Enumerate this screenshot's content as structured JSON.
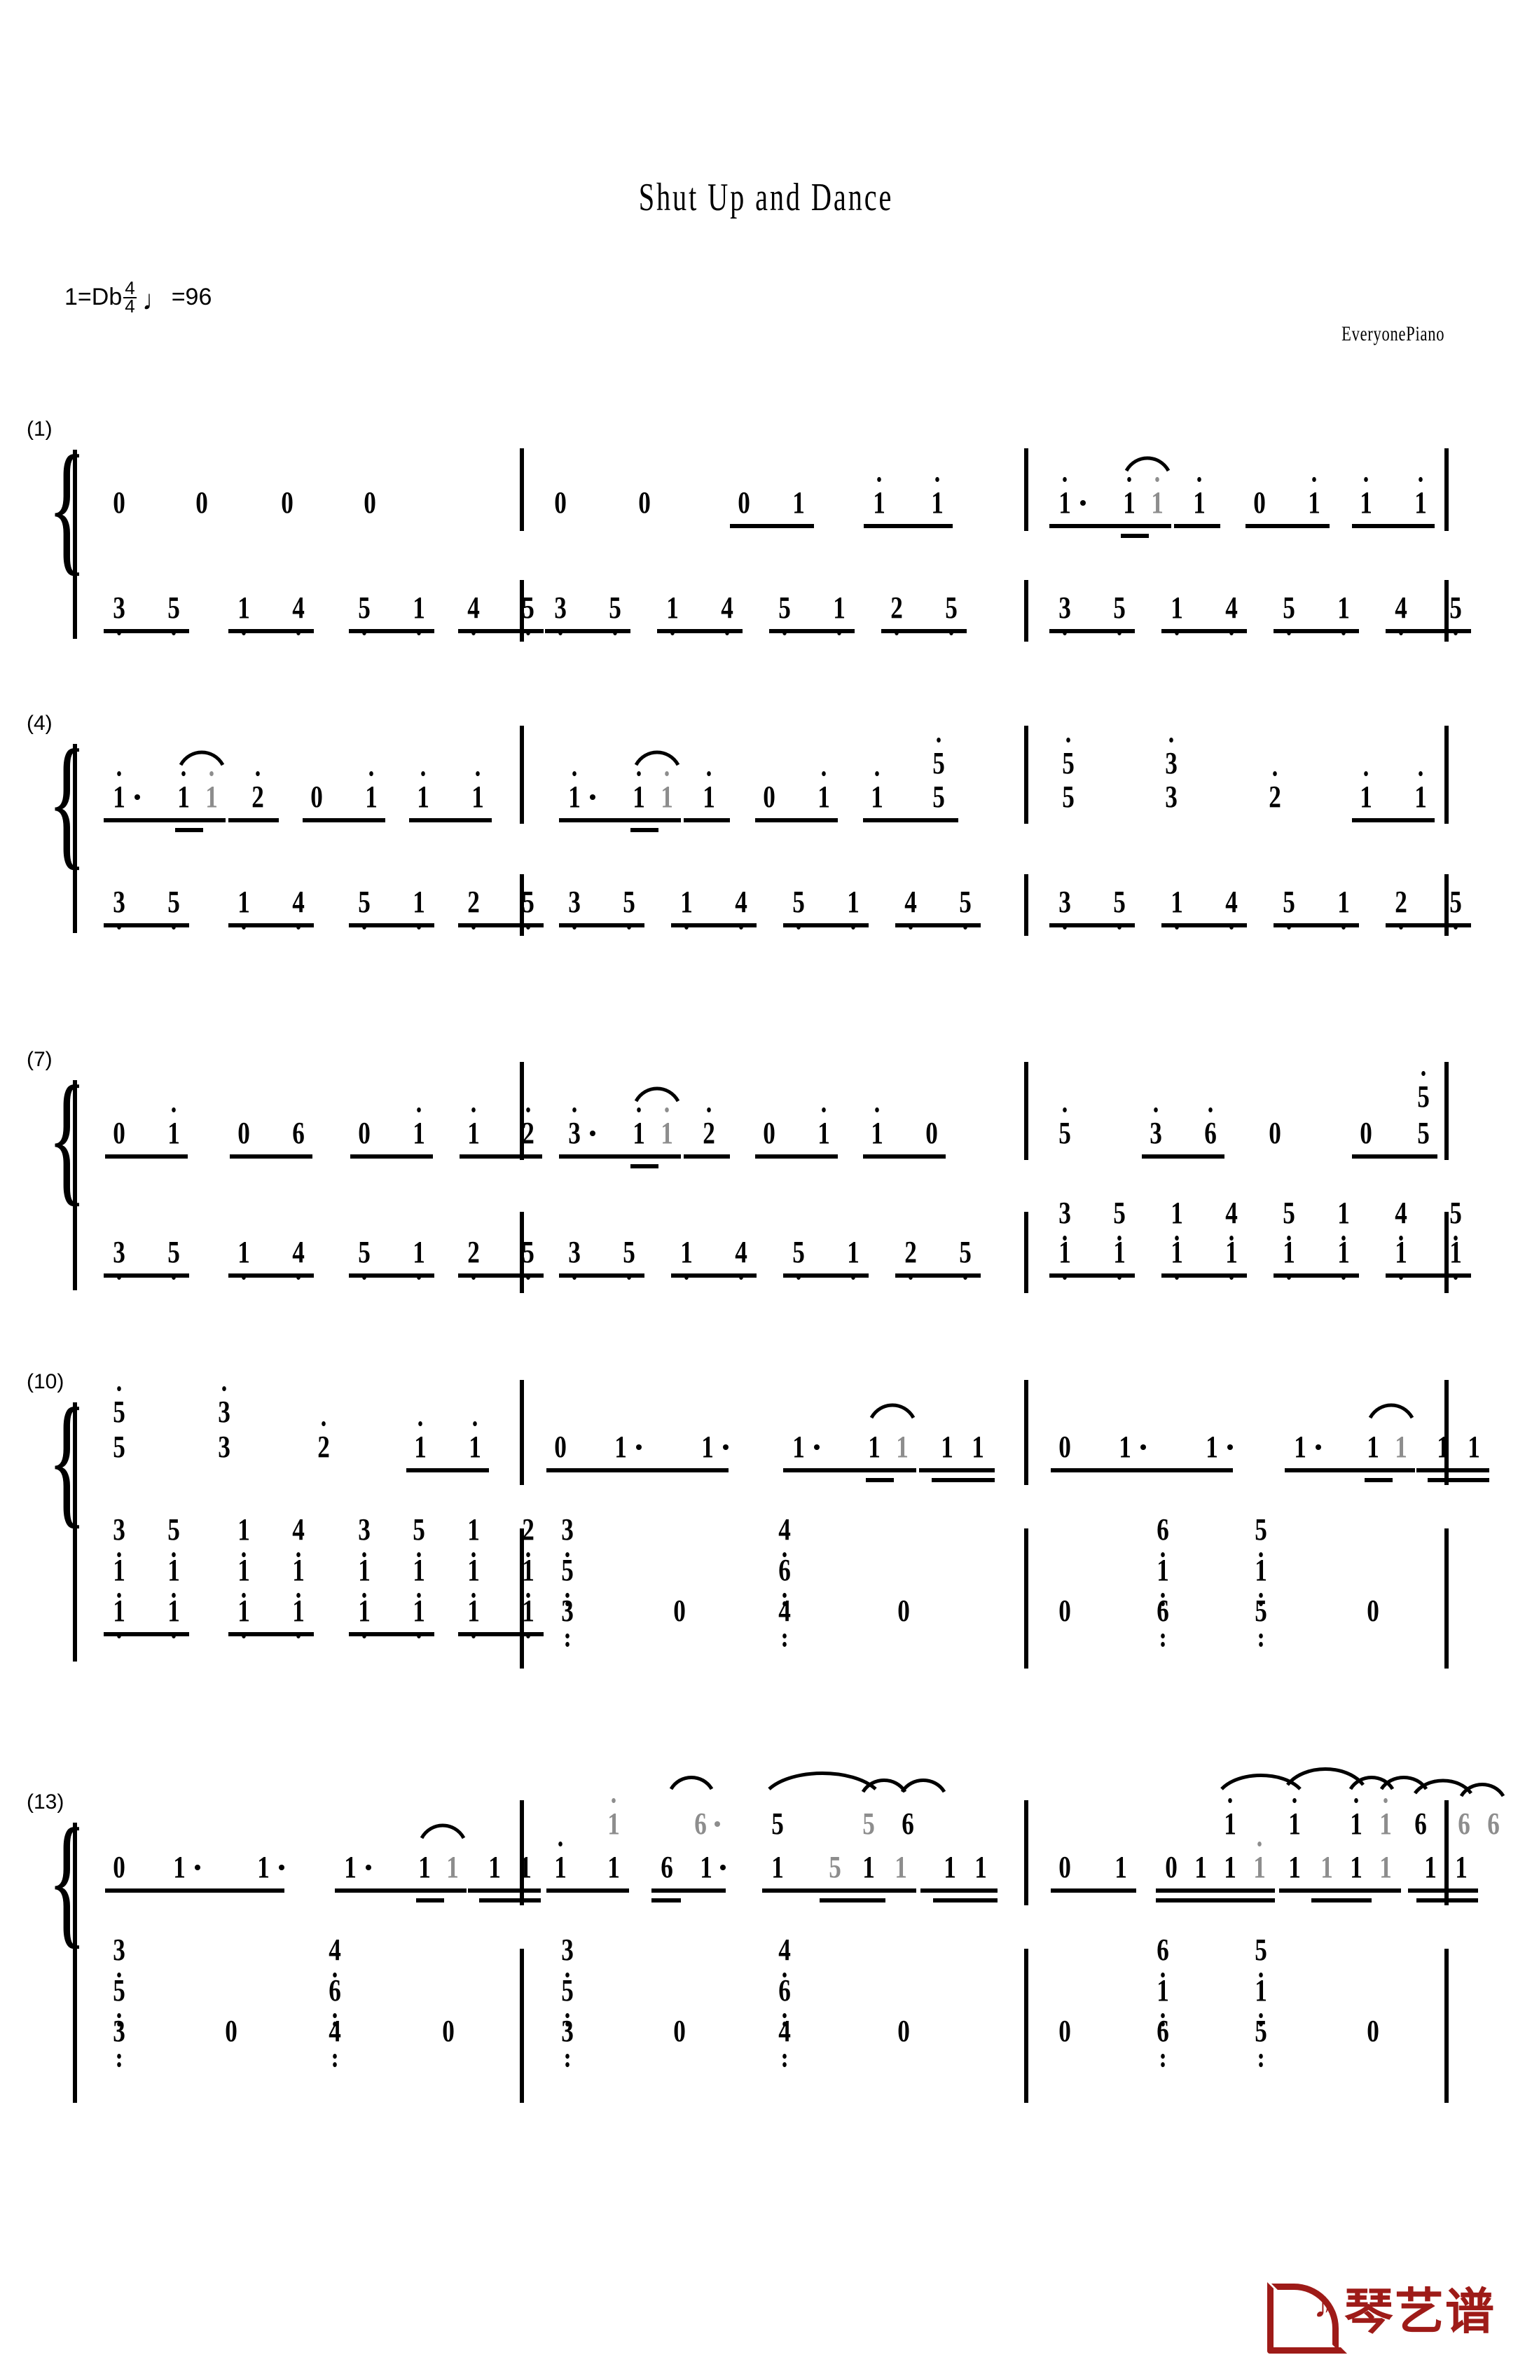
{
  "header": {
    "title": "Shut Up and Dance",
    "key_label": "1=Db",
    "time_num": "4",
    "time_den": "4",
    "tempo_note": "♩",
    "tempo_text": "=96",
    "credit": "EveryonePiano"
  },
  "footer": {
    "logo_text": "琴艺谱",
    "logo_color": "#9e1b18"
  },
  "colors": {
    "ink": "#000000",
    "ghost": "#8d8d8d",
    "paper": "#ffffff"
  },
  "systems": [
    {
      "number": "(1)",
      "measures": [
        {
          "treble": "0  0  0  0",
          "bass": "3̣ 5̣  1̣ 4̣  5̣ 1̣  4̣ 5̣"
        },
        {
          "treble": "0  0  0 1  i̇ i̇",
          "bass": "3̣ 5̣  1̣ 4̣  5̣ 1̣  2̣ 5̣"
        },
        {
          "treble": "i̇.  i̇ i̇(tie)  i̇  0 i̇  i̇ i̇",
          "bass": "3̣ 5̣  1̣ 4̣  5̣ 1̣  4̣ 5̣"
        }
      ]
    },
    {
      "number": "(4)",
      "measures": [
        {
          "treble": "i̇.  i̇ i̇(tie) 2̇  0 i̇  i̇ i̇",
          "bass": "3̣ 5̣  1̣ 4̣  5̣ 1̣  2̣ 5̣"
        },
        {
          "treble": "i̇.  i̇ i̇(tie) i̇  0 i̇  i̇ 5̇/5",
          "bass": "3̣ 5̣  1̣ 4̣  5̣ 1̣  4̣ 5̣"
        },
        {
          "treble": "5̇/5   3̇/3   2̇   i̇ i̇",
          "bass": "3̣ 5̣  1̣ 4̣  5̣ 1̣  2̣ 5̣"
        }
      ]
    },
    {
      "number": "(7)",
      "measures": [
        {
          "treble": "0 i̇  0 6  0 i̇  i̇ 2̇",
          "bass": "3̣ 5̣  1̣ 4̣  5̣ 1̣  2̣ 5̣"
        },
        {
          "treble": "3̇.  i̇ i̇(tie) 2̇  0 i̇  i̇ 0",
          "bass": "3̣ 5̣  1̣ 4̣  5̣ 1̣  2̣ 5̣"
        },
        {
          "treble": "5̇   3̇ 6   0   0 5̇",
          "bass": "3/1̣ 5/1̣  1/1̣ 4/1̣  5/1̣ 1/1̣  4/1̣ 5/1̣"
        }
      ]
    },
    {
      "number": "(10)",
      "measures": [
        {
          "treble": "5̇/5   3̇/3   2̇   i̇ i̇",
          "bass": "3/1̣/1̣̣  5/1̣/1̣̣  1/1̣/1̣̣  4/1̣/1̣̣  3/1̣/1̣̣  5/1̣/1̣̣  1/1̣/1̣̣  2/1̣/1̣̣"
        },
        {
          "treble": "0 1.  1.  1. 1 1(tie)  1 1",
          "bass": "3̣/5̣/3̣̣   0   4̣/6̣/4̣̣   0"
        },
        {
          "treble": "0 1.  1.  1. 1 1(tie)  1 1",
          "bass": "0   6̣/1̣/6̣̣   5̣/1̣/5̣̣   0"
        }
      ]
    },
    {
      "number": "(13)",
      "measures": [
        {
          "treble": "0 1.  1.  1. 1 1(tie)  1 1",
          "bass": "3̣/5̣/3̣̣   0   4̣/6̣/4̣̣   0"
        },
        {
          "treble": "i 1  6 1.  1  5 1 1  1 1",
          "treble_upper_ghost": "i̇  6.  5  5 6",
          "bass": "3̣/5̣/3̣̣   0   4̣/6̣/4̣̣   0"
        },
        {
          "treble": "0 1  0 1 1 i̇ 1  1 1 1  1 1",
          "treble_upper_ghost": "i̇ i̇  i̇ i̇ 6  6 6",
          "bass": "0   6̣/1̣/6̣̣   5̣/1̣/5̣̣   0"
        }
      ]
    }
  ]
}
